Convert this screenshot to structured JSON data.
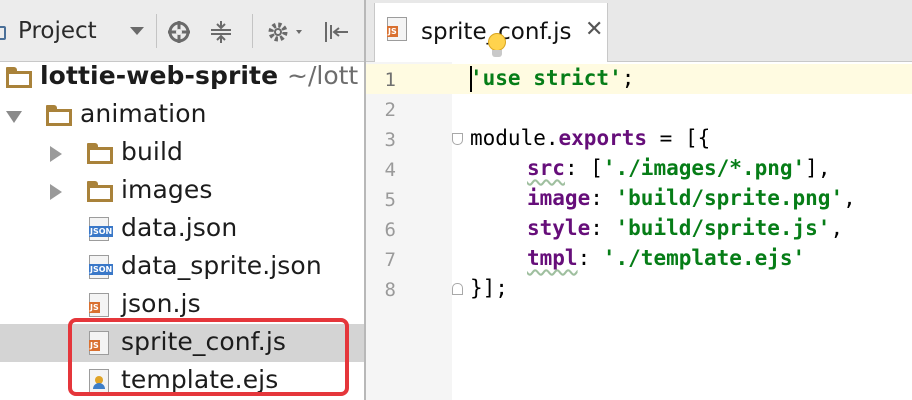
{
  "project_panel": {
    "title": "Project",
    "icons": [
      "dropdown-icon",
      "target-icon",
      "collapse-all-icon",
      "gear-icon",
      "hide-panel-icon"
    ],
    "tree": [
      {
        "label": "lottie-web-sprite",
        "hint": "~/lott",
        "kind": "root-folder"
      },
      {
        "label": "animation",
        "kind": "folder-expanded"
      },
      {
        "label": "build",
        "kind": "folder-collapsed"
      },
      {
        "label": "images",
        "kind": "folder-collapsed"
      },
      {
        "label": "data.json",
        "kind": "json-file"
      },
      {
        "label": "data_sprite.json",
        "kind": "json-file"
      },
      {
        "label": "json.js",
        "kind": "js-file"
      },
      {
        "label": "sprite_conf.js",
        "kind": "js-file",
        "selected": true
      },
      {
        "label": "template.ejs",
        "kind": "ejs-file"
      }
    ]
  },
  "editor": {
    "tab": {
      "label": "sprite_conf.js",
      "close": "✕",
      "icon": "js-file-icon"
    },
    "gutter": [
      "1",
      "2",
      "3",
      "4",
      "5",
      "6",
      "7",
      "8"
    ],
    "code": {
      "line1": {
        "s1": "'use strict'",
        "p1": ";"
      },
      "line3": {
        "p1": "module.",
        "k1": "exports",
        "p2": " = [{"
      },
      "line4": {
        "k1": "src",
        "p1": ": [",
        "s1": "'./images/*.png'",
        "p2": "],"
      },
      "line5": {
        "k1": "image",
        "p1": ": ",
        "s1": "'build/sprite.png'",
        "p2": ","
      },
      "line6": {
        "k1": "style",
        "p1": ": ",
        "s1": "'build/sprite.js'",
        "p2": ","
      },
      "line7": {
        "k1": "tmpl",
        "p1": ": ",
        "s1": "'./template.ejs'"
      },
      "line8": {
        "p1": "}];"
      }
    }
  },
  "colors": {
    "highlight_box": "#e5363b",
    "string": "#067d17",
    "keyword": "#660e7a",
    "selected_row": "#d4d4d4"
  }
}
